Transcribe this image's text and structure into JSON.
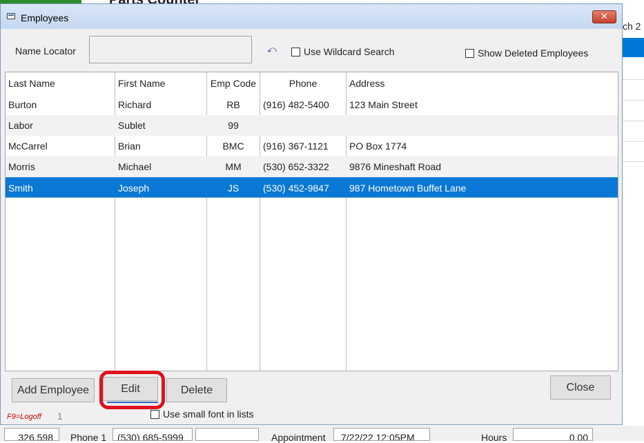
{
  "background": {
    "title": "Parts Counter",
    "right_text": "ch 2",
    "bottom": {
      "value1": "326,598",
      "phone_label": "Phone 1",
      "phone_value": "(530) 685-5999",
      "empty_value": "",
      "appointment_label": "Appointment",
      "appointment_value": "7/22/22 12:05PM",
      "hours_label": "Hours",
      "hours_value": "0.00"
    }
  },
  "dialog": {
    "title": "Employees",
    "close_glyph": "✕"
  },
  "search": {
    "name_locator_label": "Name Locator",
    "name_locator_value": "",
    "undo_glyph": "⤺",
    "wildcard_label": "Use Wildcard Search",
    "wildcard_checked": false,
    "show_deleted_label": "Show Deleted Employees",
    "show_deleted_checked": false
  },
  "table": {
    "columns": [
      "Last Name",
      "First Name",
      "Emp Code",
      "Phone",
      "Address"
    ],
    "rows": [
      {
        "last": "Burton",
        "first": "Richard",
        "code": "RB",
        "phone": "(916) 482-5400",
        "address": "123 Main Street"
      },
      {
        "last": "Labor",
        "first": "Sublet",
        "code": "99",
        "phone": "",
        "address": ""
      },
      {
        "last": "McCarrel",
        "first": "Brian",
        "code": "BMC",
        "phone": "(916) 367-1121",
        "address": "PO Box 1774"
      },
      {
        "last": "Morris",
        "first": "Michael",
        "code": "MM",
        "phone": "(530) 652-3322",
        "address": "9876 Mineshaft Road"
      },
      {
        "last": "Smith",
        "first": "Joseph",
        "code": "JS",
        "phone": "(530) 452-9847",
        "address": "987 Hometown Buffet Lane"
      }
    ],
    "selected_row": 4
  },
  "actions": {
    "add_label": "Add Employee",
    "edit_label": "Edit",
    "delete_label": "Delete",
    "close_label": "Close",
    "small_font_label": "Use small font in lists",
    "small_font_checked": false,
    "f9_hint": "F9=Logoff",
    "count": "1"
  },
  "colors": {
    "selection": "#0a78d4",
    "highlight_ring": "#e0101f",
    "f9_hint": "#cc0000"
  }
}
